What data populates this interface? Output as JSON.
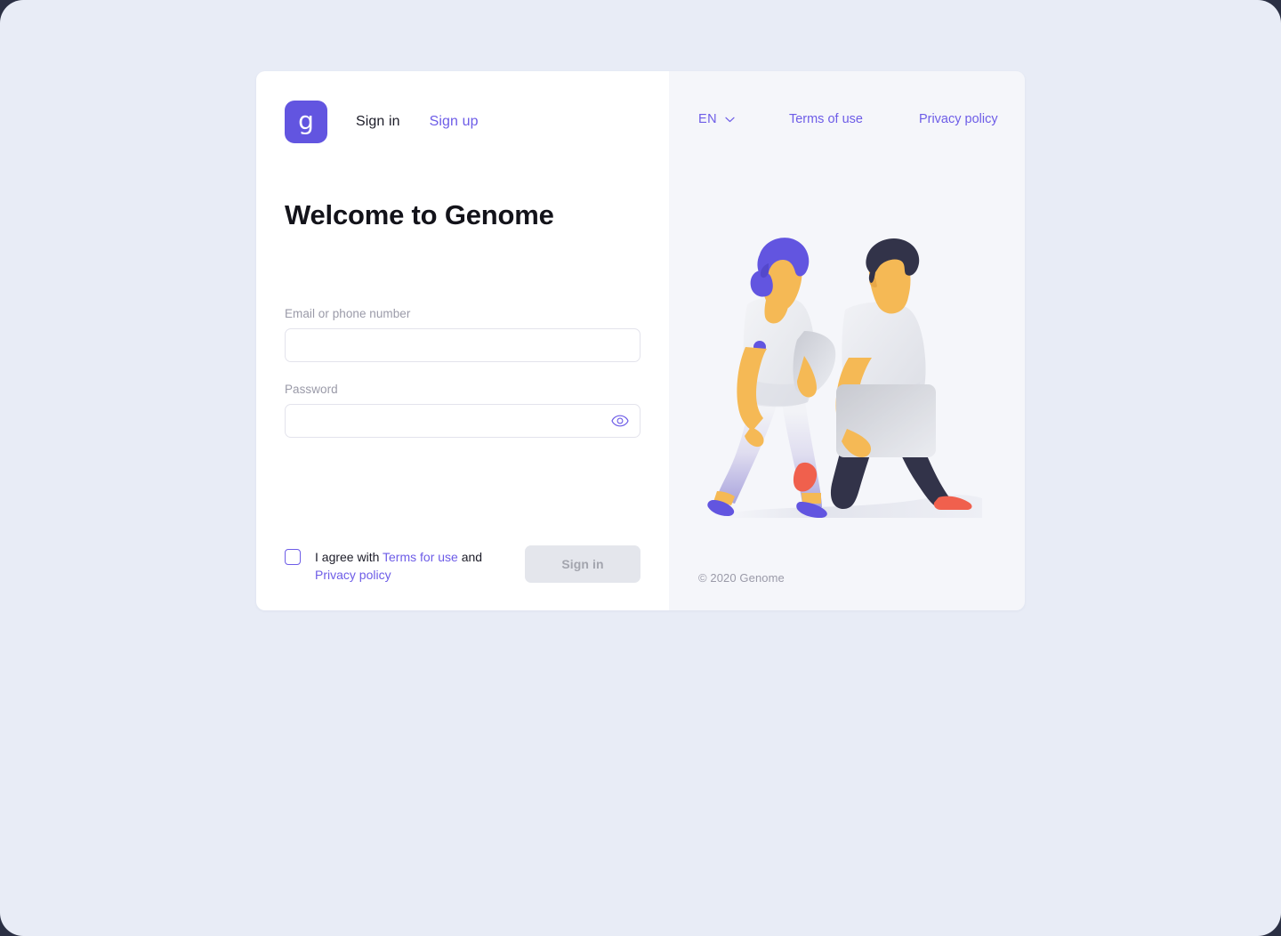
{
  "theme": {
    "page_background": "#e8ecf6",
    "outer_background": "#2b3044",
    "left_panel_background": "#ffffff",
    "right_panel_background": "#f5f6fa",
    "accent_purple": "#6d5ce7",
    "logo_purple": "#6255e0",
    "text_dark": "#1c1c28",
    "text_muted": "#9a9aa8",
    "field_border": "#e3e3ec",
    "button_disabled_bg": "#e4e6ec",
    "button_disabled_text": "#a3a5ae",
    "skin": "#f5b955",
    "hair_woman": "#6255e0",
    "hair_man": "#343murky"
  },
  "brand": {
    "logo_glyph": "g",
    "logo_icon": "genome-logo-icon"
  },
  "nav": {
    "tabs": [
      {
        "label": "Sign in",
        "active": true
      },
      {
        "label": "Sign up",
        "active": false
      }
    ]
  },
  "main": {
    "title": "Welcome to Genome"
  },
  "form": {
    "email": {
      "label": "Email or phone number",
      "value": "",
      "placeholder": ""
    },
    "password": {
      "label": "Password",
      "value": "",
      "placeholder": "",
      "toggle_icon": "eye-icon"
    },
    "agreement": {
      "checked": false,
      "prefix": "I agree with ",
      "terms_link": "Terms for use",
      "middle": " and ",
      "privacy_link": "Privacy policy"
    },
    "submit": {
      "label": "Sign in",
      "disabled": true
    }
  },
  "right": {
    "language": {
      "code": "EN",
      "chevron_icon": "chevron-down-icon"
    },
    "links": [
      {
        "label": "Terms of use"
      },
      {
        "label": "Privacy policy"
      }
    ],
    "illustration": {
      "name": "two-people-walking-with-laptops-illustration",
      "alt": "Illustration of two people walking while carrying laptops"
    },
    "copyright": "© 2020 Genome"
  }
}
